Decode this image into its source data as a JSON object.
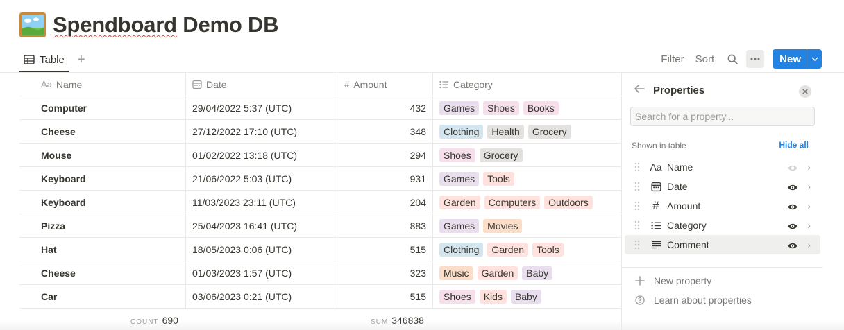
{
  "page": {
    "title_misspelled": "Spendboard",
    "title_rest": " Demo DB",
    "icon": "framed-picture-icon"
  },
  "views": {
    "active_tab": "Table",
    "add_view": "+"
  },
  "toolbar": {
    "filter": "Filter",
    "sort": "Sort",
    "new": "New"
  },
  "table": {
    "columns": [
      {
        "label": "Name",
        "icon": "Aa"
      },
      {
        "label": "Date",
        "icon": "calendar-icon"
      },
      {
        "label": "Amount",
        "icon": "#"
      },
      {
        "label": "Category",
        "icon": "list-icon"
      }
    ],
    "rows": [
      {
        "name": "Computer",
        "date": "29/04/2022 5:37 (UTC)",
        "amount": "432",
        "tags": [
          "Games",
          "Shoes",
          "Books"
        ]
      },
      {
        "name": "Cheese",
        "date": "27/12/2022 17:10 (UTC)",
        "amount": "348",
        "tags": [
          "Clothing",
          "Health",
          "Grocery"
        ]
      },
      {
        "name": "Mouse",
        "date": "01/02/2022 13:18 (UTC)",
        "amount": "294",
        "tags": [
          "Shoes",
          "Grocery"
        ]
      },
      {
        "name": "Keyboard",
        "date": "21/06/2022 5:03 (UTC)",
        "amount": "931",
        "tags": [
          "Games",
          "Tools"
        ]
      },
      {
        "name": "Keyboard",
        "date": "11/03/2023 23:11 (UTC)",
        "amount": "204",
        "tags": [
          "Garden",
          "Computers",
          "Outdoors"
        ]
      },
      {
        "name": "Pizza",
        "date": "25/04/2023 16:41 (UTC)",
        "amount": "883",
        "tags": [
          "Games",
          "Movies"
        ]
      },
      {
        "name": "Hat",
        "date": "18/05/2023 0:06 (UTC)",
        "amount": "515",
        "tags": [
          "Clothing",
          "Garden",
          "Tools"
        ]
      },
      {
        "name": "Cheese",
        "date": "01/03/2023 1:57 (UTC)",
        "amount": "323",
        "tags": [
          "Music",
          "Garden",
          "Baby"
        ]
      },
      {
        "name": "Car",
        "date": "03/06/2023 0:21 (UTC)",
        "amount": "515",
        "tags": [
          "Shoes",
          "Kids",
          "Baby"
        ]
      }
    ],
    "tag_colors": {
      "Games": "#e8deee",
      "Shoes": "#f4dfeb",
      "Books": "#f4dfeb",
      "Clothing": "#d3e5ef",
      "Health": "#e3e2e0",
      "Grocery": "#e3e2e0",
      "Tools": "#ffe2dd",
      "Garden": "#ffe2dd",
      "Computers": "#ffe2dd",
      "Outdoors": "#ffe2dd",
      "Movies": "#fadec9",
      "Music": "#fadec9",
      "Baby": "#e8deee",
      "Kids": "#ffe2dd"
    },
    "footer": {
      "count_label": "COUNT",
      "count_value": "690",
      "sum_label": "SUM",
      "sum_value": "346838"
    }
  },
  "panel": {
    "title": "Properties",
    "search_placeholder": "Search for a property...",
    "shown_label": "Shown in table",
    "hide_all": "Hide all",
    "properties": [
      {
        "label": "Name",
        "icon": "Aa",
        "visible": "muted"
      },
      {
        "label": "Date",
        "icon": "calendar-icon",
        "visible": "on"
      },
      {
        "label": "Amount",
        "icon": "#",
        "visible": "on"
      },
      {
        "label": "Category",
        "icon": "list-icon",
        "visible": "on"
      },
      {
        "label": "Comment",
        "icon": "text-icon",
        "visible": "on"
      }
    ],
    "new_property": "New property",
    "learn": "Learn about properties"
  },
  "colors": {
    "accent": "#2383e2",
    "text": "#37352f",
    "muted": "#787774"
  }
}
